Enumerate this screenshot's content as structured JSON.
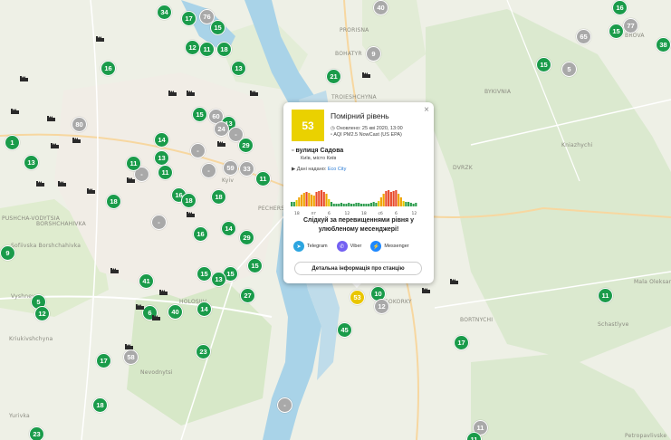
{
  "map": {
    "labels": [
      {
        "id": "prorisna",
        "text": "PRORISNA"
      },
      {
        "id": "troieshchyna",
        "text": "TROIESHCHYNA"
      },
      {
        "id": "bykivnia",
        "text": "BYKIVNIA"
      },
      {
        "id": "brova",
        "text": "BROVA"
      },
      {
        "id": "kniazhychi",
        "text": "Kniazhychi"
      },
      {
        "id": "bohatyr",
        "text": "BOHATYR"
      },
      {
        "id": "dvrzk",
        "text": "DVRZK"
      },
      {
        "id": "pushcha",
        "text": "PUSHCHA-VODYTSIA"
      },
      {
        "id": "vyshneve",
        "text": "Vyshneve"
      },
      {
        "id": "sofiivska",
        "text": "Sofiivska Borshchahivka"
      },
      {
        "id": "kriukivshchyna",
        "text": "Kriukivshchyna"
      },
      {
        "id": "nevodnytsi",
        "text": "Nevodnytsi"
      },
      {
        "id": "yurivka",
        "text": "Yurivka"
      },
      {
        "id": "schastlyve",
        "text": "Schastlyve"
      },
      {
        "id": "osokorky",
        "text": "OSOKORKY"
      },
      {
        "id": "bortnychi",
        "text": "BORTNYCHI"
      },
      {
        "id": "mala",
        "text": "Mala Oleksandrivka"
      },
      {
        "id": "petropavlivske",
        "text": "Petropavlivske"
      },
      {
        "id": "pecherskyi",
        "text": "PECHERSKYI"
      },
      {
        "id": "holosiiv",
        "text": "HOLOSIIV"
      },
      {
        "id": "borshchahivka",
        "text": "BORSHCHAHIVKA"
      },
      {
        "id": "kyiv",
        "text": "Kyiv"
      }
    ],
    "markers": [
      {
        "v": "1",
        "c": "green"
      },
      {
        "v": "13",
        "c": "green"
      },
      {
        "v": "16",
        "c": "green"
      },
      {
        "v": "34",
        "c": "green"
      },
      {
        "v": "17",
        "c": "green"
      },
      {
        "v": "76",
        "c": "gray"
      },
      {
        "v": "15",
        "c": "green"
      },
      {
        "v": "12",
        "c": "green"
      },
      {
        "v": "11",
        "c": "green"
      },
      {
        "v": "18",
        "c": "green"
      },
      {
        "v": "13",
        "c": "green"
      },
      {
        "v": "40",
        "c": "gray"
      },
      {
        "v": "9",
        "c": "gray"
      },
      {
        "v": "21",
        "c": "green"
      },
      {
        "v": "16",
        "c": "green"
      },
      {
        "v": "77",
        "c": "gray"
      },
      {
        "v": "15",
        "c": "green"
      },
      {
        "v": "65",
        "c": "gray"
      },
      {
        "v": "38",
        "c": "green"
      },
      {
        "v": "15",
        "c": "green"
      },
      {
        "v": "5",
        "c": "gray"
      },
      {
        "v": "80",
        "c": "gray"
      },
      {
        "v": "15",
        "c": "green"
      },
      {
        "v": "60",
        "c": "gray"
      },
      {
        "v": "13",
        "c": "green"
      },
      {
        "v": "24",
        "c": "gray"
      },
      {
        "v": "14",
        "c": "green"
      },
      {
        "v": "-",
        "c": "gray"
      },
      {
        "v": "29",
        "c": "green"
      },
      {
        "v": "-",
        "c": "gray"
      },
      {
        "v": "13",
        "c": "green"
      },
      {
        "v": "-",
        "c": "gray"
      },
      {
        "v": "11",
        "c": "green"
      },
      {
        "v": "-",
        "c": "gray"
      },
      {
        "v": "11",
        "c": "green"
      },
      {
        "v": "59",
        "c": "gray"
      },
      {
        "v": "33",
        "c": "gray"
      },
      {
        "v": "11",
        "c": "green"
      },
      {
        "v": "18",
        "c": "green"
      },
      {
        "v": "16",
        "c": "green"
      },
      {
        "v": "18",
        "c": "green"
      },
      {
        "v": "18",
        "c": "green"
      },
      {
        "v": "-",
        "c": "gray"
      },
      {
        "v": "14",
        "c": "green"
      },
      {
        "v": "16",
        "c": "green"
      },
      {
        "v": "29",
        "c": "green"
      },
      {
        "v": "9",
        "c": "green"
      },
      {
        "v": "15",
        "c": "green"
      },
      {
        "v": "15",
        "c": "green"
      },
      {
        "v": "15",
        "c": "green"
      },
      {
        "v": "13",
        "c": "green"
      },
      {
        "v": "41",
        "c": "green"
      },
      {
        "v": "5",
        "c": "green"
      },
      {
        "v": "27",
        "c": "green"
      },
      {
        "v": "12",
        "c": "green"
      },
      {
        "v": "6",
        "c": "green"
      },
      {
        "v": "40",
        "c": "green"
      },
      {
        "v": "14",
        "c": "green"
      },
      {
        "v": "23",
        "c": "green"
      },
      {
        "v": "17",
        "c": "green"
      },
      {
        "v": "58",
        "c": "gray"
      },
      {
        "v": "18",
        "c": "green"
      },
      {
        "v": "-",
        "c": "gray"
      },
      {
        "v": "23",
        "c": "green"
      },
      {
        "v": "45",
        "c": "green"
      },
      {
        "v": "17",
        "c": "green"
      },
      {
        "v": "53",
        "c": "yellow"
      },
      {
        "v": "10",
        "c": "green"
      },
      {
        "v": "12",
        "c": "gray"
      },
      {
        "v": "11",
        "c": "gray"
      },
      {
        "v": "11",
        "c": "green"
      },
      {
        "v": "11",
        "c": "green"
      }
    ]
  },
  "popup": {
    "aqi": "53",
    "level": "Помірний рівень",
    "updated": "Оновлено: 25 кві 2020, 13:00",
    "metric": "AQI PM2.5 NowCast (US EPA)",
    "street": "вулиця Садова",
    "city": "Київ, місто Київ",
    "source_label": "Дані надано:",
    "source_name": "Eco City",
    "hour_ticks": [
      "18",
      "пт",
      "6",
      "12",
      "18",
      "сб",
      "6",
      "12"
    ],
    "message": "Слідкуй за перевищеннями рівня у улюбленому месенджері!",
    "messengers": [
      {
        "name": "Telegram",
        "color": "#2ca5e0"
      },
      {
        "name": "Viber",
        "color": "#7360f2"
      },
      {
        "name": "Messenger",
        "color": "#1e88ff"
      }
    ],
    "detail_button": "Детальна інформація про станцію",
    "close": "×"
  }
}
